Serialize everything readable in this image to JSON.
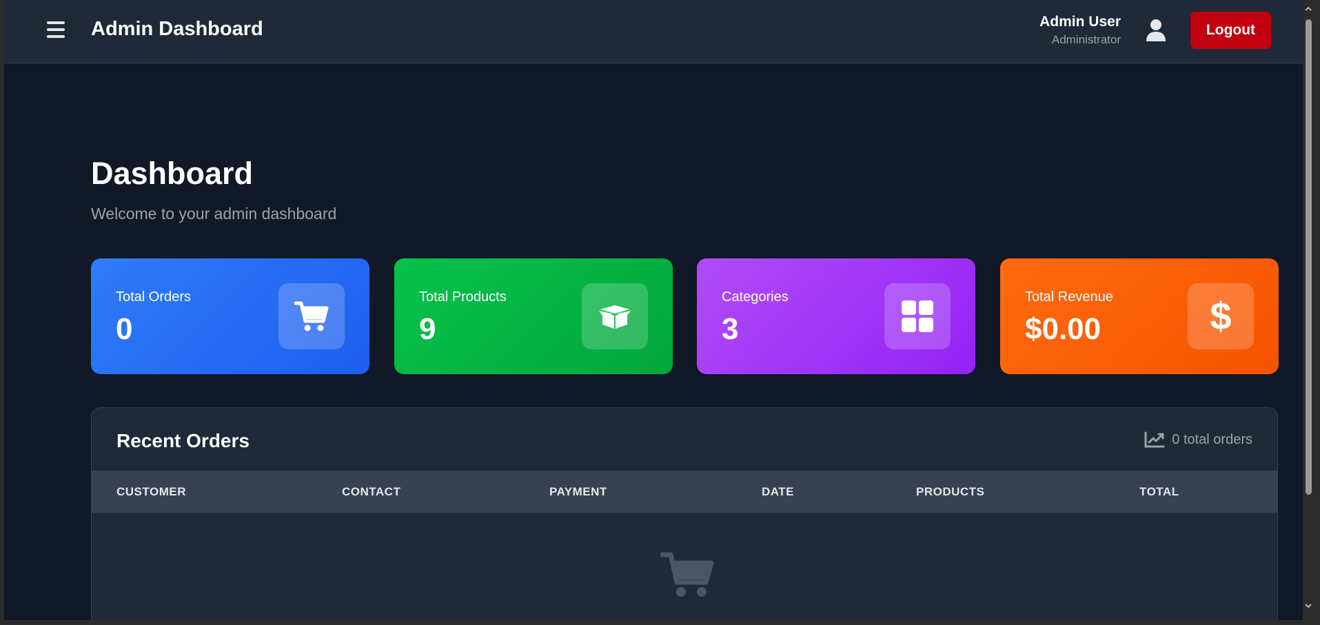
{
  "header": {
    "title": "Admin Dashboard",
    "user_name": "Admin User",
    "user_role": "Administrator",
    "logout_label": "Logout"
  },
  "page": {
    "title": "Dashboard",
    "subtitle": "Welcome to your admin dashboard"
  },
  "stats": [
    {
      "label": "Total Orders",
      "value": "0",
      "icon": "shopping-cart-icon",
      "color": "#2f7cf8"
    },
    {
      "label": "Total Products",
      "value": "9",
      "icon": "box-icon",
      "color": "#07c24a"
    },
    {
      "label": "Categories",
      "value": "3",
      "icon": "grid-icon",
      "color": "#b14cf9"
    },
    {
      "label": "Total Revenue",
      "value": "$0.00",
      "icon": "dollar-icon",
      "dollar_glyph": "$",
      "color": "#ff6a10"
    }
  ],
  "recent_orders": {
    "title": "Recent Orders",
    "count_label": "0 total orders",
    "columns": [
      "CUSTOMER",
      "CONTACT",
      "PAYMENT",
      "DATE",
      "PRODUCTS",
      "TOTAL"
    ]
  },
  "colors": {
    "background": "#111827",
    "header_bg": "#1f2937",
    "logout": "#c00010"
  }
}
